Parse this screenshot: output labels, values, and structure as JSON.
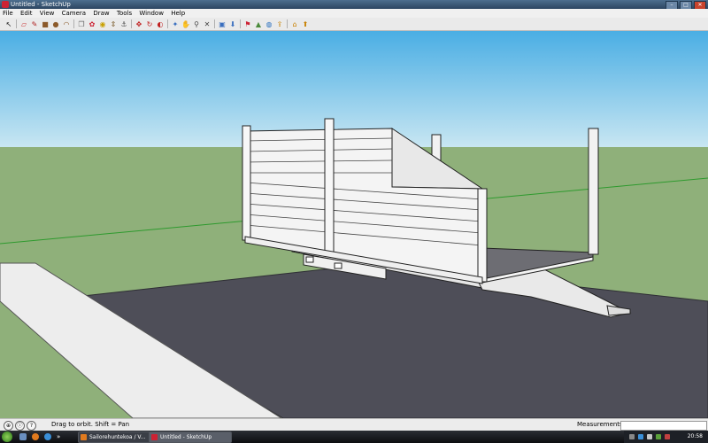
{
  "window": {
    "title": "Untitled - SketchUp",
    "controls": [
      "minimize",
      "maximize",
      "close"
    ]
  },
  "menu": [
    "File",
    "Edit",
    "View",
    "Camera",
    "Draw",
    "Tools",
    "Window",
    "Help"
  ],
  "toolbar": {
    "tools": [
      {
        "name": "select-tool",
        "glyph": "↖",
        "color": "#222"
      },
      {
        "name": "eraser-tool",
        "glyph": "▱",
        "color": "#c44"
      },
      {
        "name": "pencil-line-tool",
        "glyph": "✎",
        "color": "#b02020"
      },
      {
        "name": "rectangle-tool",
        "glyph": "■",
        "color": "#8b5a2b"
      },
      {
        "name": "circle-tool",
        "glyph": "●",
        "color": "#8b5a2b"
      },
      {
        "name": "arc-tool",
        "glyph": "◠",
        "color": "#8b5a2b"
      },
      {
        "name": "make-component-tool",
        "glyph": "❒",
        "color": "#666"
      },
      {
        "name": "paint-bucket-tool",
        "glyph": "✿",
        "color": "#c23"
      },
      {
        "name": "tape-measure-tool",
        "glyph": "◉",
        "color": "#c8a000"
      },
      {
        "name": "push-pull-tool",
        "glyph": "⇕",
        "color": "#7b5b2a"
      },
      {
        "name": "follow-me-tool",
        "glyph": "⚓",
        "color": "#555"
      },
      {
        "name": "move-tool",
        "glyph": "✥",
        "color": "#c02020"
      },
      {
        "name": "rotate-tool",
        "glyph": "↻",
        "color": "#c02020"
      },
      {
        "name": "offset-tool",
        "glyph": "◐",
        "color": "#c02020"
      },
      {
        "name": "orbit-tool",
        "glyph": "✦",
        "color": "#3a6fbf"
      },
      {
        "name": "pan-tool",
        "glyph": "✋",
        "color": "#666"
      },
      {
        "name": "zoom-tool",
        "glyph": "⚲",
        "color": "#444"
      },
      {
        "name": "zoom-extents-tool",
        "glyph": "✕",
        "color": "#444"
      },
      {
        "name": "get-photo-texture-tool",
        "glyph": "▣",
        "color": "#3a6fbf"
      },
      {
        "name": "get-models-tool",
        "glyph": "⬇",
        "color": "#3a6fbf"
      },
      {
        "name": "add-location-tool",
        "glyph": "⚑",
        "color": "#c23"
      },
      {
        "name": "toggle-terrain-tool",
        "glyph": "▲",
        "color": "#4a8a3a"
      },
      {
        "name": "preview-in-google-earth-tool",
        "glyph": "◍",
        "color": "#2a6fbf"
      },
      {
        "name": "share-model-tool",
        "glyph": "⇪",
        "color": "#c88000"
      },
      {
        "name": "get-models-warehouse-tool",
        "glyph": "⌂",
        "color": "#c88000"
      },
      {
        "name": "share-component-tool",
        "glyph": "⬆",
        "color": "#c88000"
      }
    ],
    "separators_after": [
      0,
      5,
      10,
      13,
      17,
      19,
      23
    ]
  },
  "status": {
    "icons": [
      "geolocation-icon",
      "credits-icon",
      "help-icon"
    ],
    "hint": "Drag to orbit.  Shift = Pan",
    "measurements_label": "Measurements",
    "measurements_value": ""
  },
  "taskbar": {
    "quick_launch": [
      "show-desktop-icon",
      "firefox-icon",
      "media-player-icon",
      "overflow-chevron"
    ],
    "tasks": [
      {
        "name": "task-browser",
        "label": "Sailorehuntekoa / V...",
        "active": false
      },
      {
        "name": "task-sketchup",
        "label": "Untitled - SketchUp",
        "active": true
      }
    ],
    "clock": "20:58"
  }
}
